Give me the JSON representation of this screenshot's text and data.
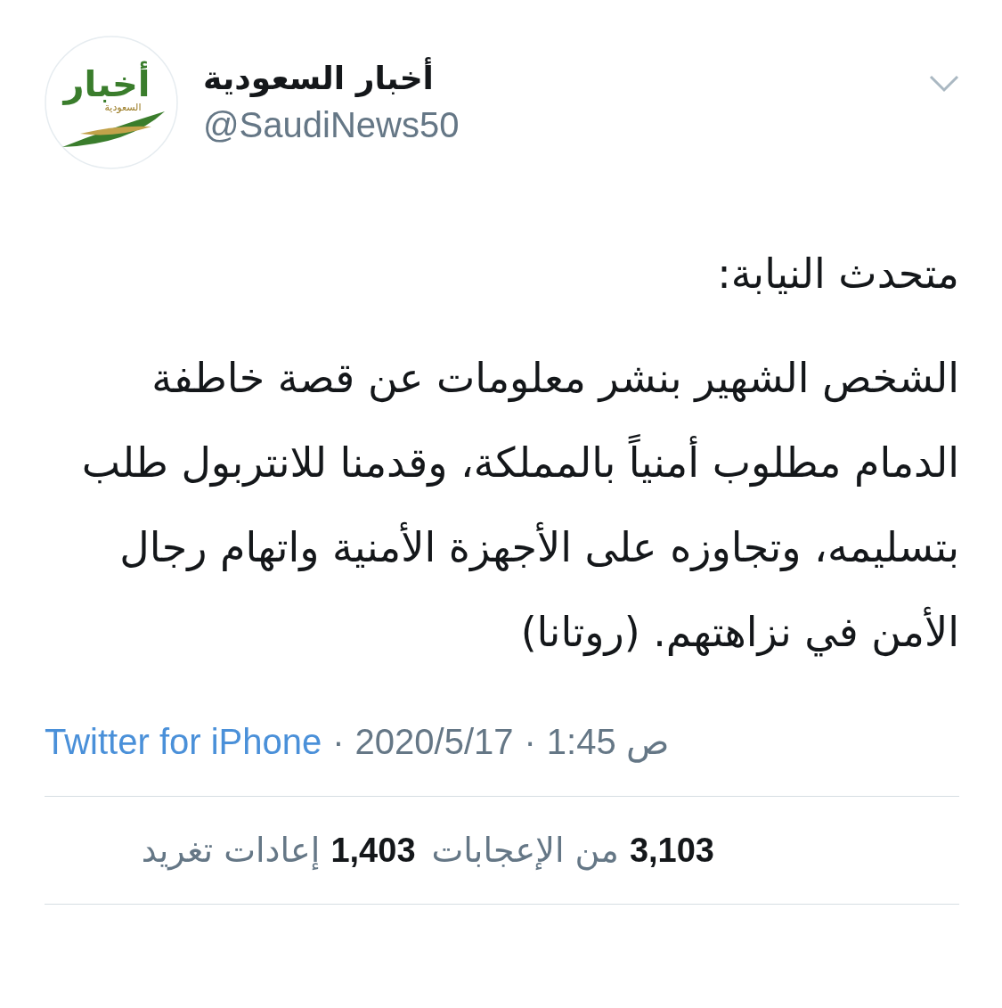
{
  "author": {
    "name": "أخبار السعودية",
    "handle": "@SaudiNews50",
    "logo_title": "أخبار",
    "logo_subtitle": "السعودية"
  },
  "tweet": {
    "heading": "متحدث النيابة:",
    "body": "الشخص الشهير بنشر معلومات عن قصة خاطفة الدمام مطلوب أمنياً بالمملكة، وقدمنا للانتربول طلب بتسليمه، وتجاوزه على الأجهزة الأمنية واتهام رجال الأمن في نزاهتهم. (روتانا)"
  },
  "meta": {
    "source": "Twitter for iPhone",
    "separator": "·",
    "date": "2020/5/17",
    "time": "ص 1:45"
  },
  "stats": [
    {
      "count": "3,103",
      "label": "من الإعجابات"
    },
    {
      "count": "1,403",
      "label": "إعادات تغريد"
    }
  ]
}
